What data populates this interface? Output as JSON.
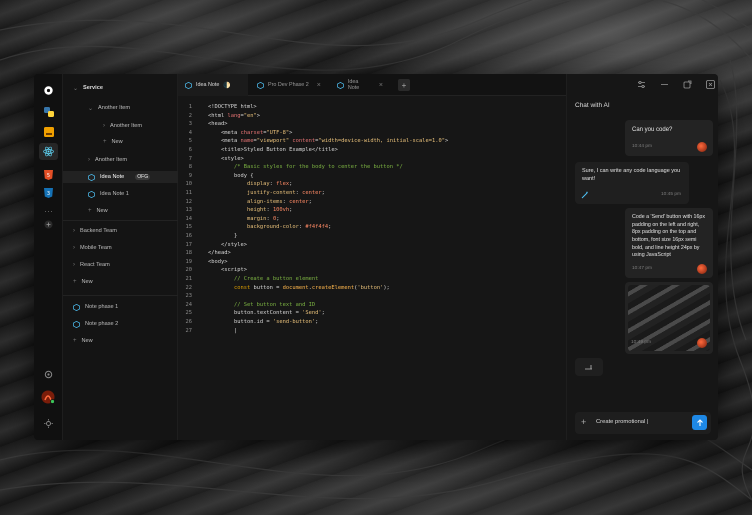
{
  "tabs": [
    {
      "label": "Idea Note",
      "active": true,
      "indicator": "🌓"
    },
    {
      "label": "Pro Dev Phase 2"
    },
    {
      "label": "Idea Note"
    }
  ],
  "new_tab_label": "+",
  "sidebar": {
    "items": [
      {
        "label": "Service",
        "level": 0
      },
      {
        "label": "Another Item",
        "level": 1
      },
      {
        "label": "New",
        "level": 2
      },
      {
        "label": "Another Item",
        "level": 2
      },
      {
        "label": "Another Item",
        "level": 1
      },
      {
        "label": "Idea Note",
        "level": 1,
        "badge": "OFG"
      },
      {
        "label": "Idea Note 1",
        "level": 1
      },
      {
        "label": "New",
        "level": 1
      },
      {
        "label": "Backend Team",
        "level": 0
      },
      {
        "label": "Mobile Team",
        "level": 0
      },
      {
        "label": "React Team",
        "level": 0
      },
      {
        "label": "New",
        "level": 0
      },
      {
        "label": "Note phase 1",
        "level": 0
      },
      {
        "label": "Note phase 2",
        "level": 0
      },
      {
        "label": "New",
        "level": 0
      }
    ]
  },
  "code_lines": [
    "<!DOCTYPE html>",
    "<html lang=\"en\">",
    "<head>",
    "    <meta charset=\"UTF-8\">",
    "    <meta name=\"viewport\" content=\"width=device-width, initial-scale=1.0\">",
    "    <title>Styled Button Example</title>",
    "    <style>",
    "        /* Basic styles for the body to center the button */",
    "        body {",
    "            display: flex;",
    "            justify-content: center;",
    "            align-items: center;",
    "            height: 100vh;",
    "            margin: 0;",
    "            background-color: #f4f4f4;",
    "        }",
    "    </style>",
    "</head>",
    "<body>",
    "    <script>",
    "        // Create a button element",
    "        const button = document.createElement('button');",
    "",
    "        // Set button text and ID",
    "        button.textContent = 'Send';",
    "        button.id = 'send-button';",
    "        |"
  ],
  "chat": {
    "title": "Chat with AI",
    "messages": [
      {
        "role": "user",
        "text": "Can you code?",
        "time": "10:44 pm"
      },
      {
        "role": "ai",
        "text": "Sure, I can write any code language you want!",
        "time": "10:45 pm"
      },
      {
        "role": "user",
        "text": "Code a 'Send' button with 16px padding on the left and right, 8px padding on the top and bottom, font size 16px semi bold, and line height 24px by using JavaScript",
        "time": "10:47 pm"
      },
      {
        "role": "user",
        "text": "",
        "time": "10:49 pm",
        "image": true
      }
    ],
    "input_value": "Create promotional |"
  },
  "colors": {
    "accent": "#1e88e5",
    "avatar": "#c0391b"
  }
}
